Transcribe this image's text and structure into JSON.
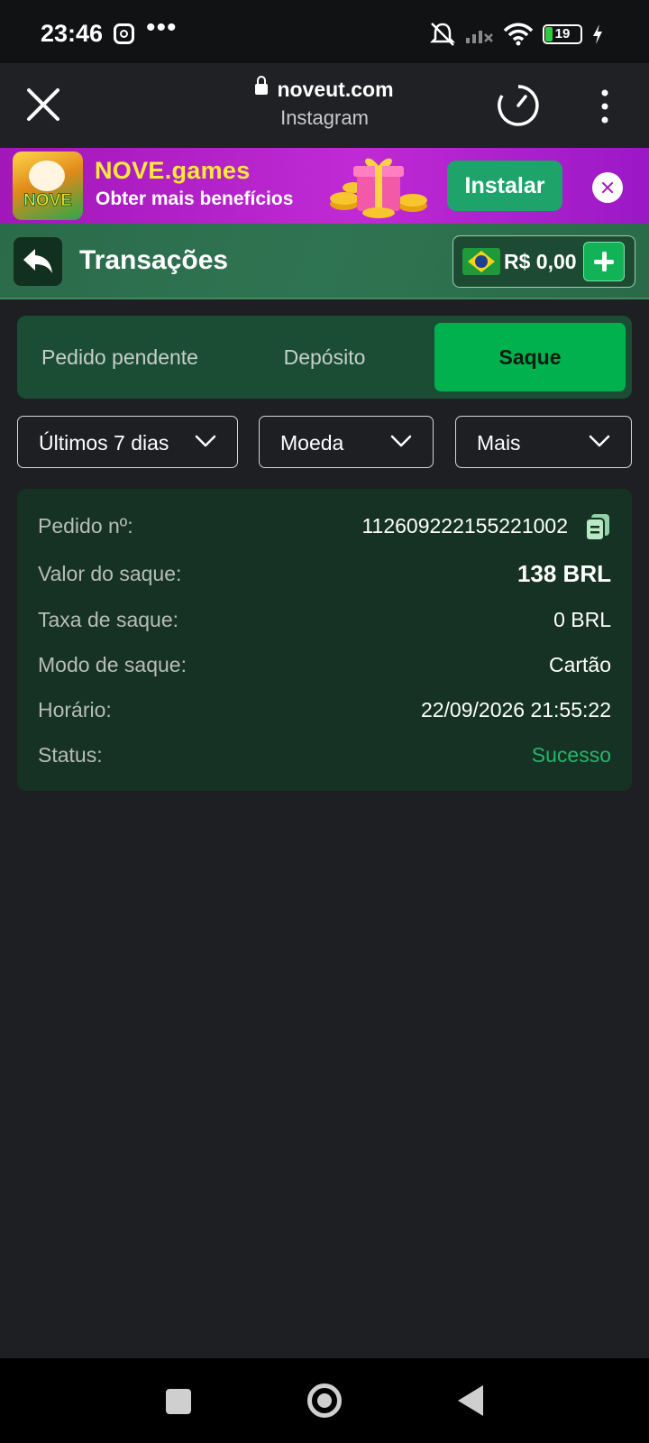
{
  "status_bar": {
    "time": "23:46",
    "more": "•••",
    "battery": "19",
    "icons": [
      "instagram-icon",
      "silent-icon",
      "signal-icon",
      "wifi-icon",
      "battery-icon",
      "charging-icon"
    ]
  },
  "browser": {
    "domain": "noveut.com",
    "source": "Instagram",
    "icons": [
      "close-icon",
      "lock-icon",
      "timer-icon",
      "more-vertical-icon"
    ]
  },
  "promo": {
    "title": "NOVE.games",
    "subtitle": "Obter mais benefícios",
    "install_label": "Instalar",
    "logo_text": "NOVE",
    "colors": {
      "background": "#b21fc9",
      "title": "#ffe93a",
      "install": "#1ea36a"
    }
  },
  "header": {
    "title": "Transações",
    "balance": "R$ 0,00",
    "colors": {
      "background": "#2b6b4a",
      "accent": "#12b356"
    }
  },
  "tabs": [
    {
      "label": "Pedido pendente",
      "active": false
    },
    {
      "label": "Depósito",
      "active": false
    },
    {
      "label": "Saque",
      "active": true
    }
  ],
  "filters": [
    {
      "label": "Últimos 7 dias"
    },
    {
      "label": "Moeda"
    },
    {
      "label": "Mais"
    }
  ],
  "transaction": {
    "order_label": "Pedido nº:",
    "order_value": "112609222155221002",
    "amount_label": "Valor do saque:",
    "amount_value": "138 BRL",
    "fee_label": "Taxa de saque:",
    "fee_value": "0 BRL",
    "mode_label": "Modo de saque:",
    "mode_value": "Cartão",
    "time_label": "Horário:",
    "time_value": "22/09/2026 21:55:22",
    "status_label": "Status:",
    "status_value": "Sucesso",
    "colors": {
      "card": "#163224",
      "success": "#2ab36b"
    }
  }
}
